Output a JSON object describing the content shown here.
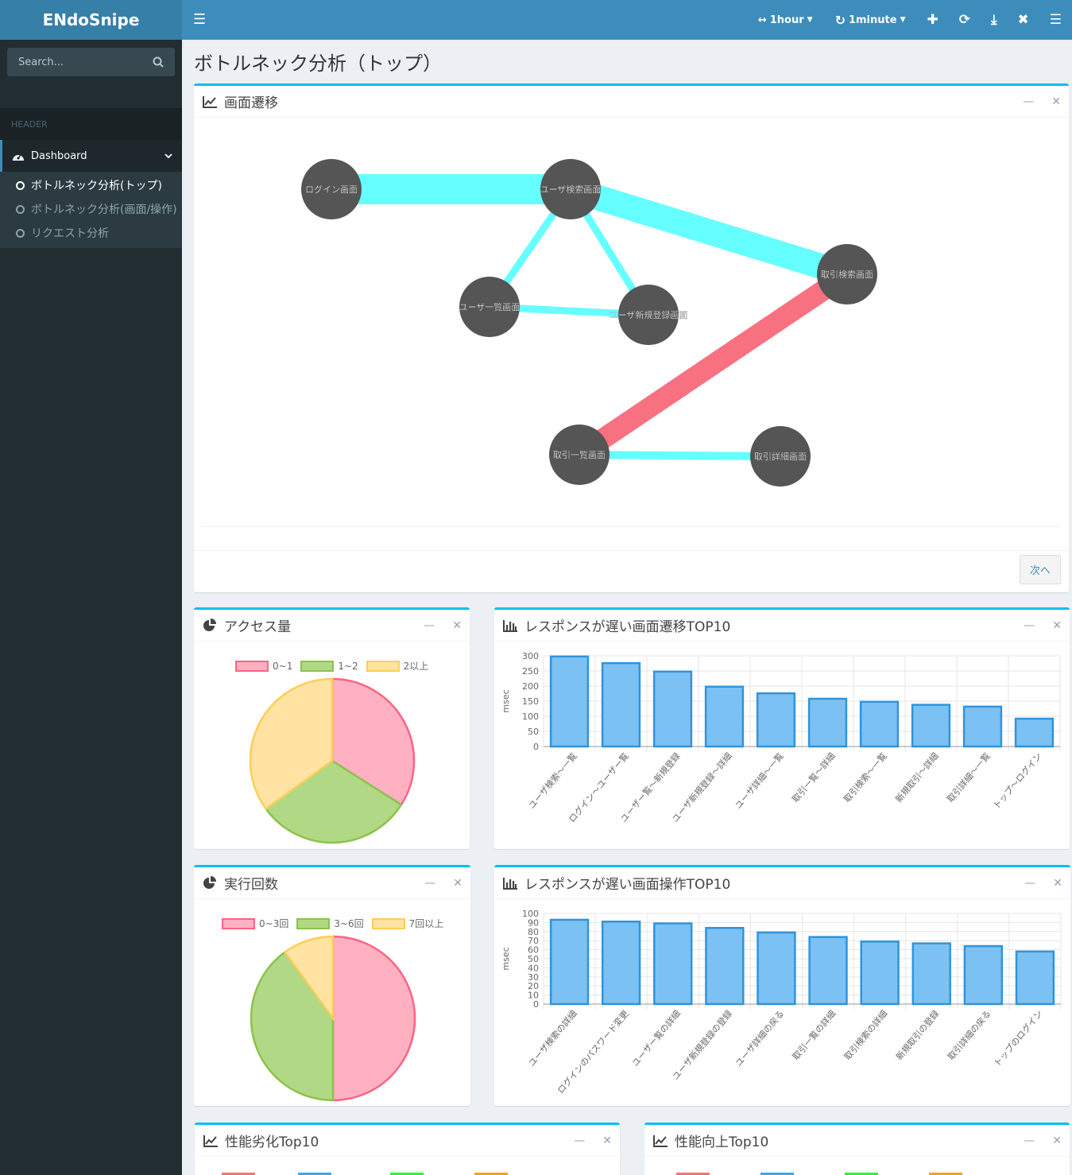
{
  "app": {
    "logo": "ENdoSnipe"
  },
  "sidebar": {
    "search_placeholder": "Search...",
    "header": "HEADER",
    "dashboard": "Dashboard",
    "items": [
      {
        "label": "ボトルネック分析(トップ)",
        "active": true
      },
      {
        "label": "ボトルネック分析(画面/操作)",
        "active": false
      },
      {
        "label": "リクエスト分析",
        "active": false
      }
    ]
  },
  "topbar": {
    "range": "1hour",
    "interval": "1minute"
  },
  "page": {
    "title": "ボトルネック分析（トップ）"
  },
  "graph_box": {
    "title": "画面遷移",
    "next": "次へ",
    "nodes": [
      {
        "id": "login",
        "label": "ログイン画面"
      },
      {
        "id": "usersearch",
        "label": "ユーザ検索画面"
      },
      {
        "id": "userlist",
        "label": "ユーザ一覧画面"
      },
      {
        "id": "userreg",
        "label": "ユーザ新規登録画面"
      },
      {
        "id": "tradesearch",
        "label": "取引検索画面"
      },
      {
        "id": "tradelist",
        "label": "取引一覧画面"
      },
      {
        "id": "tradedetail",
        "label": "取引詳細画面"
      }
    ],
    "edges": [
      {
        "from": "login",
        "to": "usersearch",
        "color": "#66ffff"
      },
      {
        "from": "usersearch",
        "to": "tradesearch",
        "color": "#66ffff"
      },
      {
        "from": "usersearch",
        "to": "userlist",
        "color": "#66ffff"
      },
      {
        "from": "usersearch",
        "to": "userreg",
        "color": "#66ffff"
      },
      {
        "from": "userlist",
        "to": "userreg",
        "color": "#66ffff"
      },
      {
        "from": "tradesearch",
        "to": "tradelist",
        "color": "#f87180"
      },
      {
        "from": "tradelist",
        "to": "tradedetail",
        "color": "#66ffff"
      }
    ]
  },
  "access_box": {
    "title": "アクセス量",
    "chart_data": {
      "type": "pie",
      "labels": [
        "0~1",
        "1~2",
        "2以上"
      ],
      "values": [
        34,
        31,
        35
      ],
      "colors": [
        "#ffb1c1",
        "#b1d884",
        "#ffe3a3"
      ],
      "borders": [
        "#ff6384",
        "#8bc34a",
        "#ffcd56"
      ]
    }
  },
  "exec_box": {
    "title": "実行回数",
    "chart_data": {
      "type": "pie",
      "labels": [
        "0~3回",
        "3~6回",
        "7回以上"
      ],
      "values": [
        50,
        40,
        10
      ],
      "colors": [
        "#ffb1c1",
        "#b1d884",
        "#ffe3a3"
      ],
      "borders": [
        "#ff6384",
        "#8bc34a",
        "#ffcd56"
      ]
    }
  },
  "slow_trans_box": {
    "title": "レスポンスが遅い画面遷移TOP10",
    "chart_data": {
      "type": "bar",
      "ylabel": "msec",
      "ylim": [
        0,
        300
      ],
      "yticks": [
        0,
        50,
        100,
        150,
        200,
        250,
        300
      ],
      "categories": [
        "ユーザ検索〜一覧",
        "ログイン〜ユーザー覧",
        "ユーザー覧〜新規登録",
        "ユーザ新規登録〜詳細",
        "ユーザ詳細〜一覧",
        "取引一覧〜詳細",
        "取引検索〜一覧",
        "新規取引〜詳細",
        "取引詳細〜一覧",
        "トップ〜ログイン"
      ],
      "values": [
        298,
        276,
        248,
        198,
        176,
        158,
        148,
        138,
        132,
        92
      ]
    }
  },
  "slow_op_box": {
    "title": "レスポンスが遅い画面操作TOP10",
    "chart_data": {
      "type": "bar",
      "ylabel": "msec",
      "ylim": [
        0,
        100
      ],
      "yticks": [
        0,
        10,
        20,
        30,
        40,
        50,
        60,
        70,
        80,
        90,
        100
      ],
      "categories": [
        "ユーザ検索の詳細",
        "ログインのパスワード変更",
        "ユーザー覧の詳細",
        "ユーザ新規登録の登録",
        "ユーザ詳細の戻る",
        "取引一覧の詳細",
        "取引検索の詳細",
        "新規取引の登録",
        "取引詳細の戻る",
        "トップのログイン"
      ],
      "values": [
        93,
        91,
        89,
        84,
        79,
        74,
        69,
        67,
        64,
        58
      ]
    }
  },
  "degrade_box": {
    "title": "性能劣化Top10"
  },
  "improve_box": {
    "title": "性能向上Top10"
  }
}
